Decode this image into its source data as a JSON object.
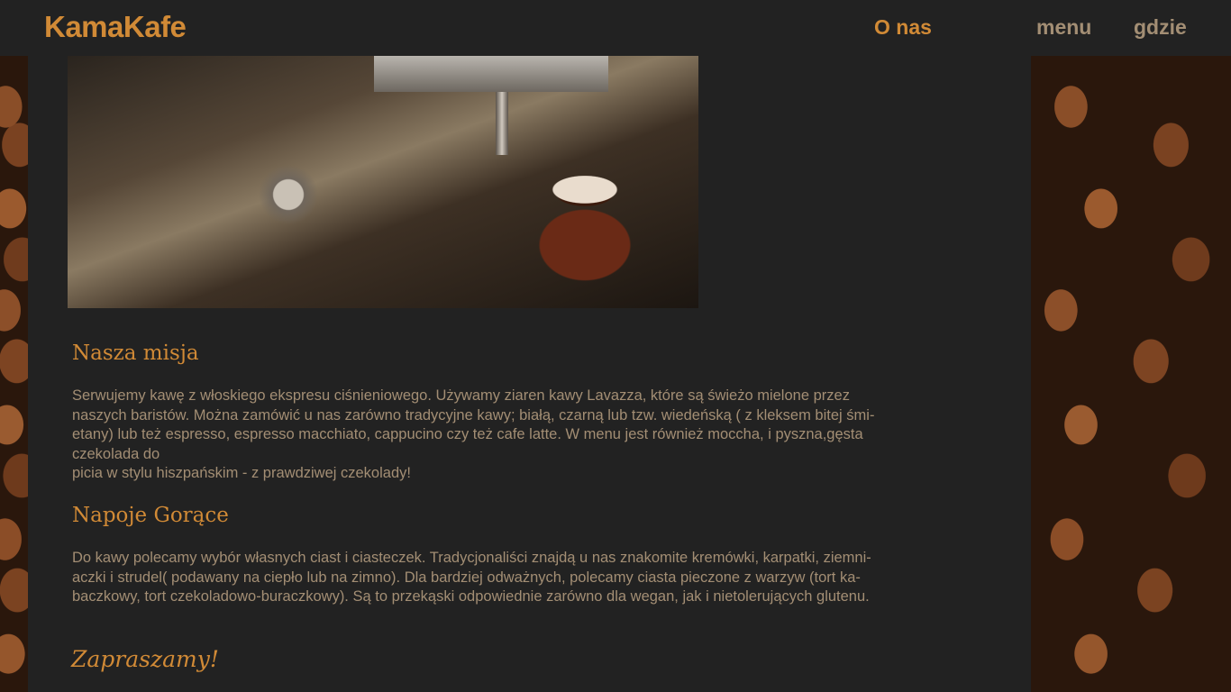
{
  "header": {
    "logo": "KamaKafe",
    "nav": [
      {
        "label": "O nas"
      },
      {
        "label": "menu"
      },
      {
        "label": "gdzie"
      }
    ]
  },
  "main": {
    "hero_image": "espresso-machine-photo",
    "mission": {
      "title": "Nasza misja",
      "line1": "Serwujemy kawę z włoskiego ekspresu ciśnieniowego. Używamy ziaren kawy Lavazza, które są świeżo mielone przez",
      "line2": "naszych baristów. Można zamówić u nas zarówno tradycyjne kawy; białą, czarną lub tzw. wiedeńską ( z kleksem bitej śmi-",
      "line3": "etany) lub też espresso, espresso macchiato, cappucino czy też cafe latte. W menu jest również moccha, i pyszna,gęsta",
      "line4": "czekolada do",
      "line5": "picia w stylu hiszpańskim - z prawdziwej czekolady!"
    },
    "hot_drinks": {
      "title": "Napoje Gorące",
      "line1": "Do kawy polecamy wybór własnych ciast i ciasteczek. Tradycjonaliści znajdą u nas znakomite kremówki, karpatki, ziemni-",
      "line2": "aczki i strudel( podawany na ciepło lub na zimno). Dla bardziej odważnych, polecamy ciasta pieczone z warzyw (tort ka-",
      "line3": "baczkowy, tort czekoladowo-buraczkowy). Są to przekąski odpowiednie zarówno dla wegan, jak i nietolerujących glutenu."
    },
    "invite": "Zapraszamy!"
  },
  "colors": {
    "accent": "#d18a36",
    "text": "#a38e74",
    "background": "#222222"
  }
}
